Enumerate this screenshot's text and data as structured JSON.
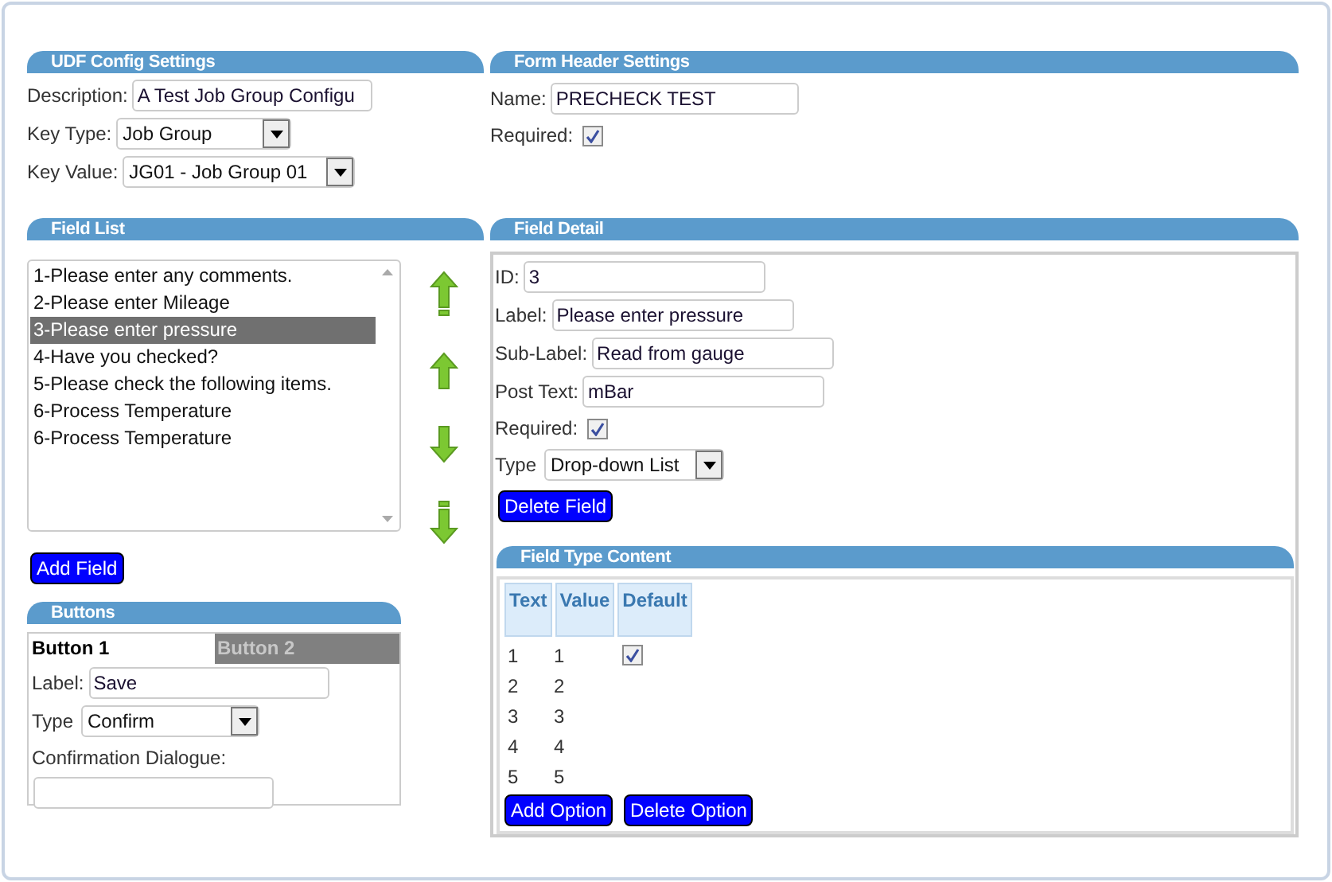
{
  "udf_config": {
    "title": "UDF Config Settings",
    "description": {
      "label": "Description:",
      "value": "A Test Job Group Configu"
    },
    "key_type": {
      "label": "Key Type:",
      "value": "Job Group"
    },
    "key_value": {
      "label": "Key Value:",
      "value": "JG01 - Job Group 01"
    }
  },
  "form_header": {
    "title": "Form Header Settings",
    "name": {
      "label": "Name:",
      "value": "PRECHECK TEST"
    },
    "required": {
      "label": "Required:",
      "checked": true
    }
  },
  "field_list": {
    "title": "Field List",
    "items": [
      {
        "label": "1-Please enter any comments.",
        "selected": false
      },
      {
        "label": "2-Please enter Mileage",
        "selected": false
      },
      {
        "label": "3-Please enter pressure",
        "selected": true
      },
      {
        "label": "4-Have you checked?",
        "selected": false
      },
      {
        "label": "5-Please check the following items.",
        "selected": false
      },
      {
        "label": "6-Process Temperature",
        "selected": false
      },
      {
        "label": "6-Process Temperature",
        "selected": false
      }
    ],
    "add_button": "Add Field"
  },
  "buttons_panel": {
    "title": "Buttons",
    "tabs": [
      {
        "label": "Button 1",
        "selected": true
      },
      {
        "label": "Button 2",
        "selected": false
      }
    ],
    "label_field": {
      "label": "Label:",
      "value": "Save"
    },
    "type_field": {
      "label": "Type",
      "value": "Confirm"
    },
    "confirmation": {
      "label": "Confirmation Dialogue:"
    }
  },
  "field_detail": {
    "title": "Field Detail",
    "id": {
      "label": "ID:",
      "value": "3"
    },
    "label": {
      "label": "Label:",
      "value": "Please enter pressure"
    },
    "sub_label": {
      "label": "Sub-Label:",
      "value": "Read from gauge"
    },
    "post_text": {
      "label": "Post Text:",
      "value": "mBar"
    },
    "required": {
      "label": "Required:",
      "checked": true
    },
    "type": {
      "label": "Type",
      "value": "Drop-down List"
    },
    "delete_button": "Delete Field",
    "field_type_content": {
      "title": "Field Type Content",
      "columns": [
        "Text",
        "Value",
        "Default"
      ],
      "rows": [
        {
          "text": "1",
          "value": "1",
          "default": true
        },
        {
          "text": "2",
          "value": "2",
          "default": false
        },
        {
          "text": "3",
          "value": "3",
          "default": false
        },
        {
          "text": "4",
          "value": "4",
          "default": false
        },
        {
          "text": "5",
          "value": "5",
          "default": false
        }
      ],
      "buttons": [
        "Add Option",
        "Delete Option"
      ]
    }
  }
}
